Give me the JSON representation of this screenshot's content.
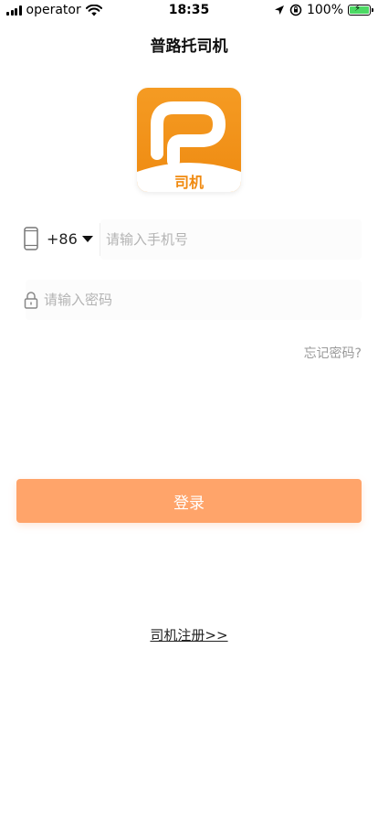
{
  "status_bar": {
    "carrier": "operator",
    "time": "18:35",
    "battery": "100%"
  },
  "nav": {
    "title": "普路托司机"
  },
  "logo": {
    "label": "司机",
    "brand_color": "#f0890f"
  },
  "phone_field": {
    "country_code": "+86",
    "placeholder": "请输入手机号",
    "value": ""
  },
  "password_field": {
    "placeholder": "请输入密码",
    "value": ""
  },
  "links": {
    "forgot_password": "忘记密码?",
    "register": "司机注册>>"
  },
  "actions": {
    "login_label": "登录",
    "login_color": "#ffa46a"
  }
}
